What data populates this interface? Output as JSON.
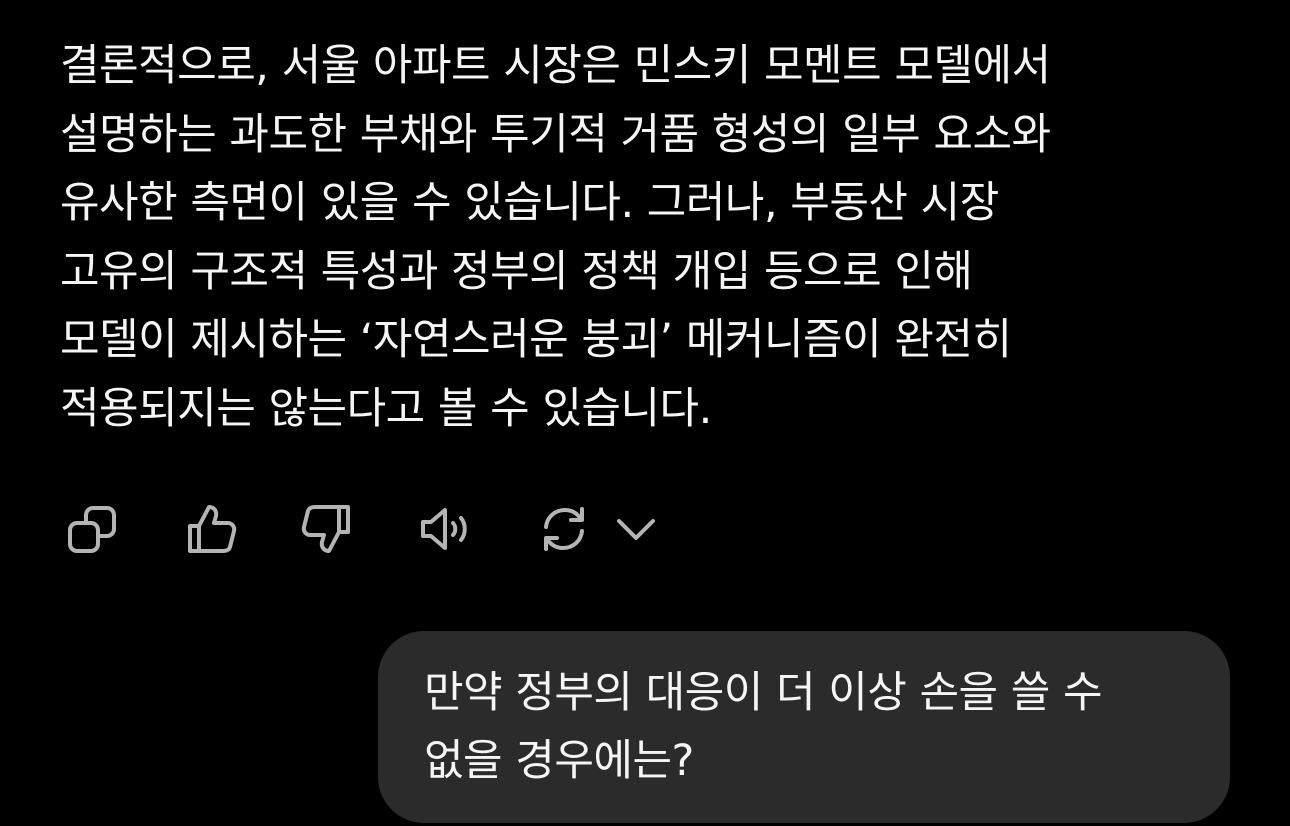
{
  "assistant_message": {
    "lines": [
      "결론적으로, 서울 아파트 시장은 민스키 모멘트 모델에서",
      "설명하는 과도한 부채와 투기적 거품 형성의 일부 요소와",
      "유사한 측면이 있을 수 있습니다. 그러나, 부동산 시장",
      "고유의 구조적 특성과 정부의 정책 개입 등으로 인해",
      "모델이 제시하는 ‘자연스러운 붕괴’ 메커니즘이 완전히",
      "적용되지는 않는다고 볼 수 있습니다."
    ]
  },
  "actions": {
    "icons": [
      "copy-icon",
      "thumbs-up-icon",
      "thumbs-down-icon",
      "read-aloud-icon",
      "regenerate-icon",
      "chevron-down-icon"
    ]
  },
  "user_message": {
    "lines": [
      "만약 정부의 대응이 더 이상 손을 쓸 수",
      "없을 경우에는?"
    ]
  },
  "colors": {
    "background": "#000000",
    "text": "#f5f5f5",
    "icon": "#b4b4b4",
    "bubble": "#2b2b2b"
  }
}
